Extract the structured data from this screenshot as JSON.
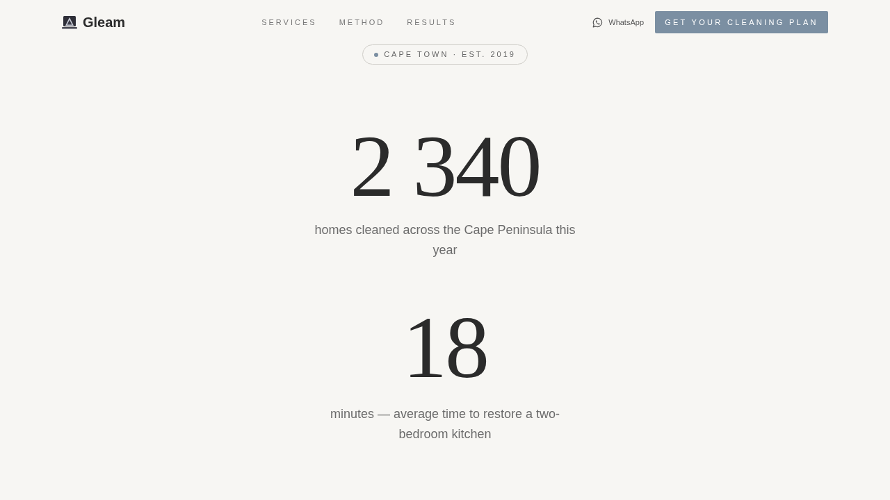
{
  "header": {
    "brand": "Gleam",
    "nav": [
      "SERVICES",
      "METHOD",
      "RESULTS"
    ],
    "whatsapp": "WhatsApp",
    "cta": "GET YOUR CLEANING PLAN"
  },
  "badge": {
    "text": "CAPE TOWN · EST. 2019"
  },
  "stats": [
    {
      "value": "2 340",
      "caption": "homes cleaned across the Cape Peninsula this year"
    },
    {
      "value": "18",
      "caption": "minutes — average time to restore a two-bedroom kitchen"
    }
  ]
}
